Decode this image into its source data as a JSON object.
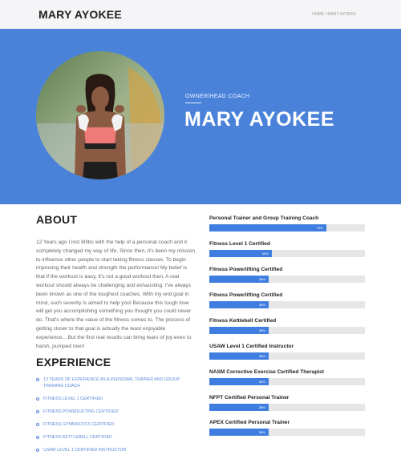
{
  "header": {
    "site_title": "MARY AYOKEE",
    "breadcrumb": "HOME / MARY AYOKEE"
  },
  "hero": {
    "role": "OWNER/HEAD COACH",
    "name": "MARY AYOKEE",
    "photo_alt": "coach-portrait"
  },
  "about": {
    "heading": "ABOUT",
    "text": "12 Years ago I lost 80lbs with the help of a personal coach and it completely changed my way of life. Since then, it's been my mission to influence other people to start taking fitness classes. To begin improving their health and strength the performance! My belief is that if the workout is easy, it's not a good workout then. A real workout should always be challenging and exhausting. I've always been known as one of the toughest coaches. With my end goal in mind, such severity is aimed to help you! Because this tough love will get you accomplishing something you thought you could never do. That's where the value of the fitness comes to. The process of getting closer to that goal is actually the least enjoyable experience... But the first real results can bring tears of joy even to harsh, pumped men!"
  },
  "experience": {
    "heading": "EXPERIENCE",
    "items": [
      "13 YEARS OF EXPERIENCE AS A PERSONAL TRAINER AND GROUP TRAINING COACH",
      "FITNESS LEVEL 1 CERTIFIED",
      "FITNESS POWERLIFTING CERTIFIED",
      "FITNESS GYMNASTICS CERTIFIED",
      "FITNESS KETTLEBELL CERTIFIED",
      "USAW LEVEL 1 CERTIFIED INSTRUCTOR"
    ]
  },
  "certifications": [
    {
      "title": "Personal Trainer and Group Training Coach",
      "percent": 75,
      "label": "75%"
    },
    {
      "title": "Fitness Level 1 Certified",
      "percent": 40,
      "label": "40%"
    },
    {
      "title": "Fitness Powerlifting Certified",
      "percent": 38,
      "label": "38%"
    },
    {
      "title": "Fitness Powerlifting Certified",
      "percent": 38,
      "label": "38%"
    },
    {
      "title": "Fitness Kettlebell Certified",
      "percent": 38,
      "label": "38%"
    },
    {
      "title": "USAW Level 1 Certified Instructor",
      "percent": 38,
      "label": "38%"
    },
    {
      "title": "NASM Corrective Exercise Certified Therapist",
      "percent": 38,
      "label": "38%"
    },
    {
      "title": "NFPT Certified Personal Trainer",
      "percent": 38,
      "label": "38%"
    },
    {
      "title": "APEX Certified Personal Trainer",
      "percent": 38,
      "label": "38%"
    }
  ],
  "colors": {
    "hero_bg": "#4a82da",
    "bar_fill": "#3f7ee0",
    "bar_track": "#e6e6e6",
    "accent_text": "#5b8ad8"
  }
}
